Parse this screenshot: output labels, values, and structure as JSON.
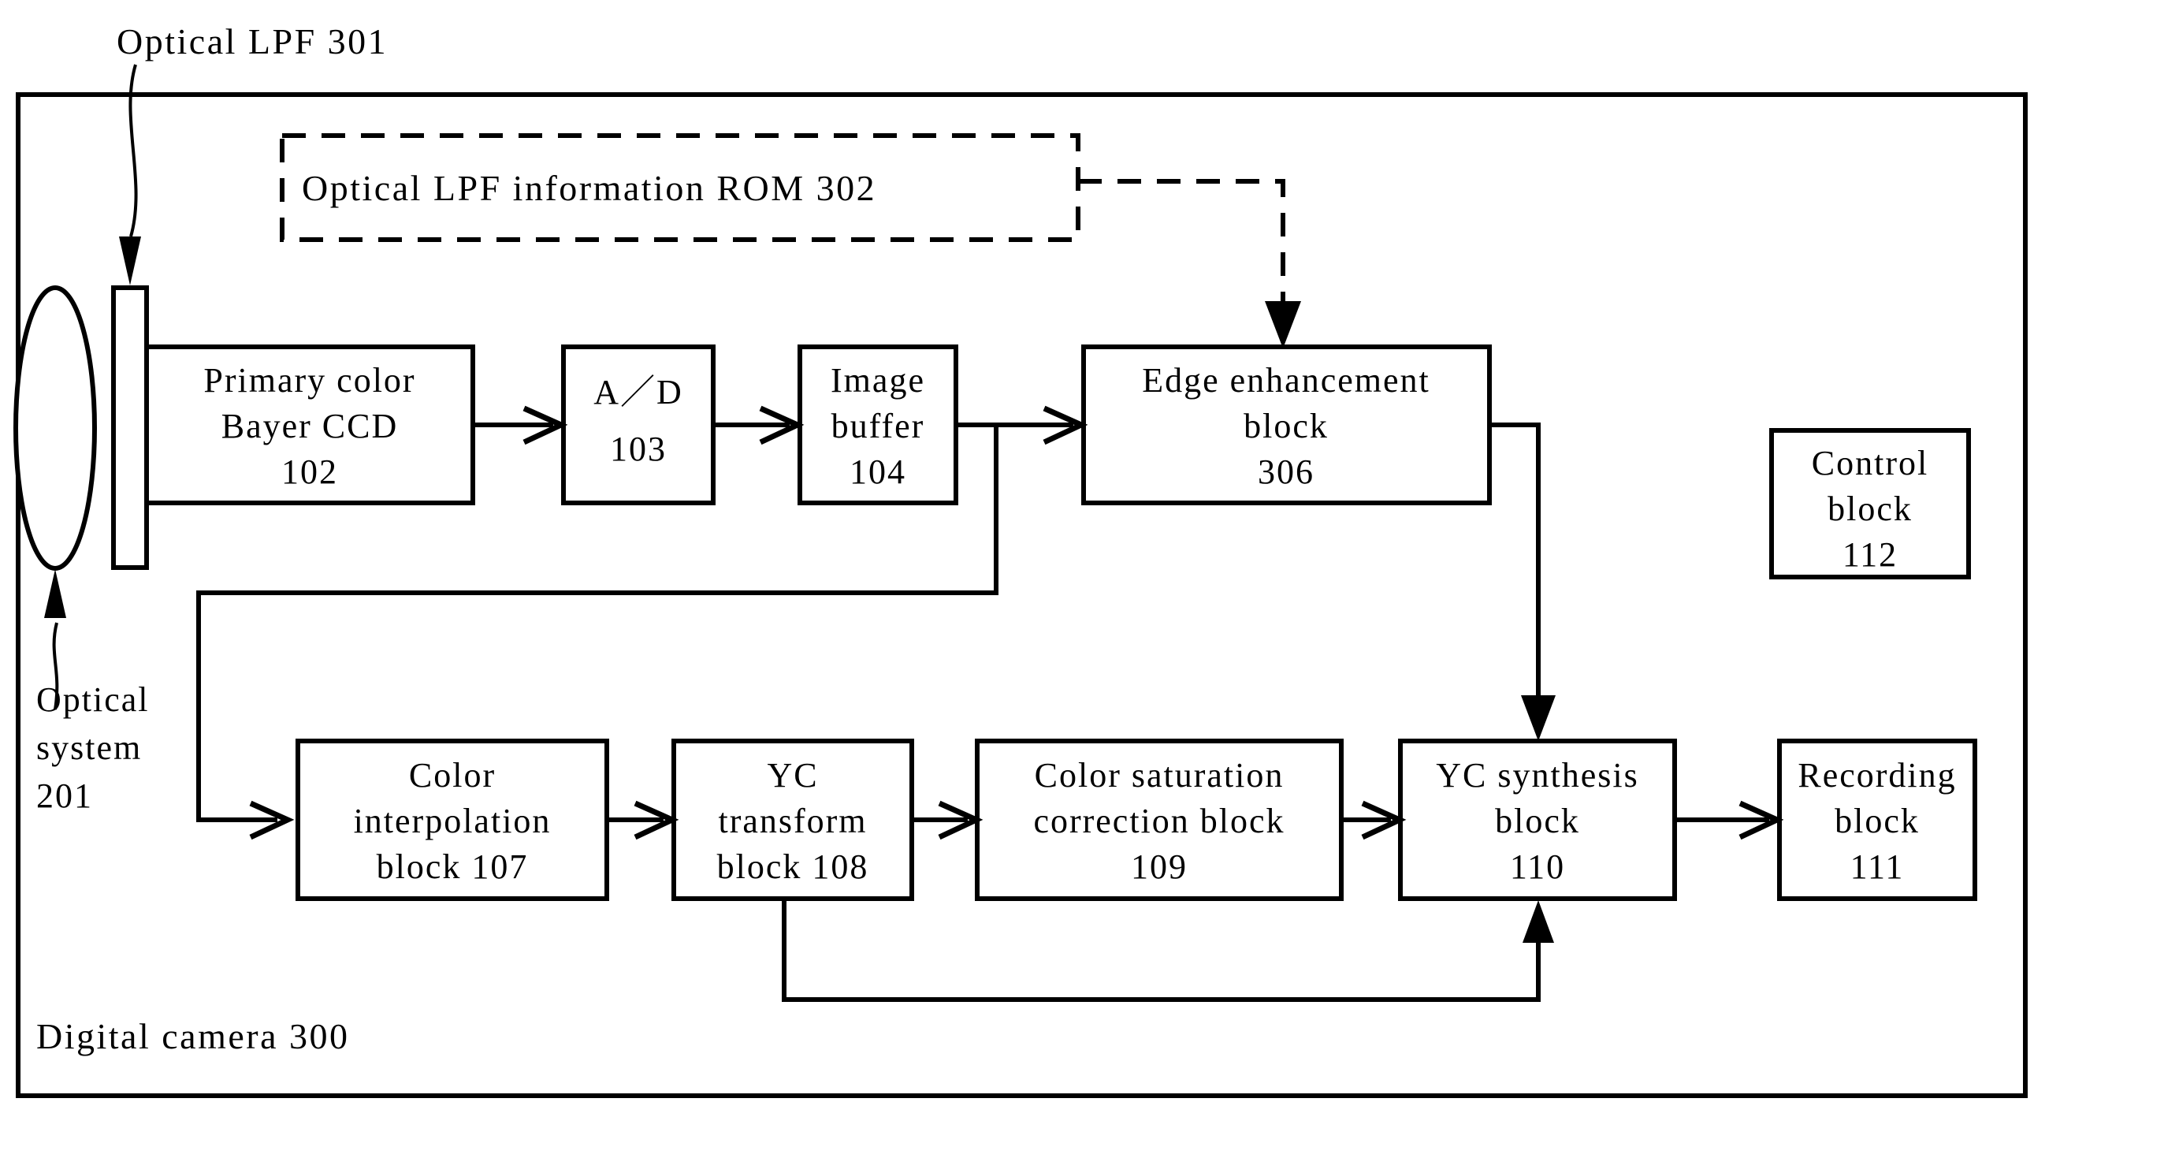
{
  "figure": {
    "kind": "patent-block-diagram",
    "outer_label": "Digital camera 300",
    "callouts": {
      "optical_lpf": "Optical LPF 301",
      "optical_system": [
        "Optical",
        "system",
        "201"
      ]
    },
    "rom_block": {
      "label": "Optical LPF information ROM 302",
      "style": "dashed"
    },
    "blocks": [
      {
        "id": "ccd",
        "lines": [
          "Primary color",
          "Bayer CCD",
          "102"
        ]
      },
      {
        "id": "ad",
        "lines": [
          "A／D",
          "103"
        ]
      },
      {
        "id": "imgbuf",
        "lines": [
          "Image",
          "buffer",
          "104"
        ]
      },
      {
        "id": "edge",
        "lines": [
          "Edge enhancement",
          "block",
          "306"
        ]
      },
      {
        "id": "control",
        "lines": [
          "Control",
          "block",
          "112"
        ]
      },
      {
        "id": "colorint",
        "lines": [
          "Color",
          "interpolation",
          "block 107"
        ]
      },
      {
        "id": "yctrans",
        "lines": [
          "YC",
          "transform",
          "block 108"
        ]
      },
      {
        "id": "colorsat",
        "lines": [
          "Color saturation",
          "correction block",
          "109"
        ]
      },
      {
        "id": "ycsynth",
        "lines": [
          "YC synthesis",
          "block",
          "110"
        ]
      },
      {
        "id": "record",
        "lines": [
          "Recording",
          "block",
          "111"
        ]
      }
    ],
    "colors": {
      "ink": "#000000",
      "paper": "#ffffff"
    }
  }
}
